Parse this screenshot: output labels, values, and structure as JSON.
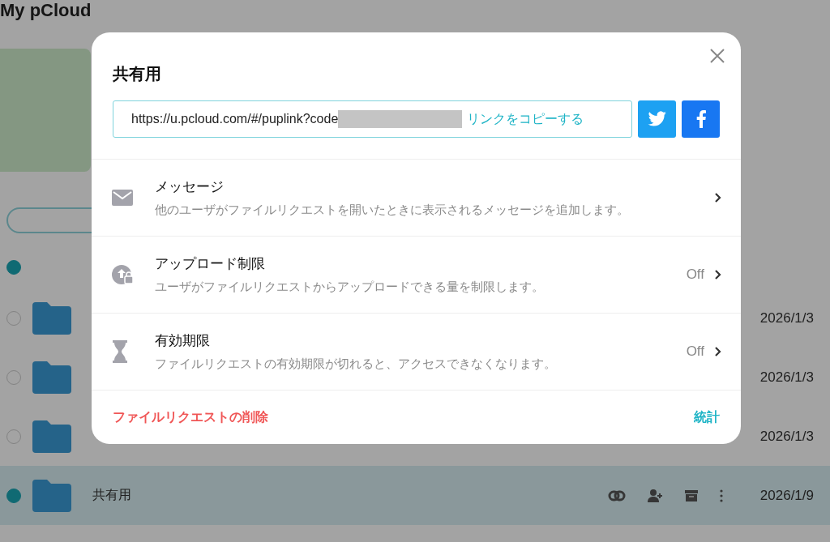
{
  "app": {
    "title": "My pCloud",
    "all_selected": true,
    "rows": [
      {
        "date": "2026/1/3",
        "selected": false
      },
      {
        "date": "2026/1/3",
        "selected": false
      },
      {
        "date": "2026/1/3",
        "selected": false
      },
      {
        "name": "共有用",
        "date": "2026/1/9",
        "selected": true
      }
    ]
  },
  "dialog": {
    "title": "共有用",
    "link": {
      "value": "https://u.pcloud.com/#/puplink?code",
      "copy_label": "リンクをコピーする"
    },
    "options": [
      {
        "kind": "message",
        "title": "メッセージ",
        "description": "他のユーザがファイルリクエストを開いたときに表示されるメッセージを追加します。"
      },
      {
        "kind": "upload_limit",
        "title": "アップロード制限",
        "description": "ユーザがファイルリクエストからアップロードできる量を制限します。",
        "value": "Off"
      },
      {
        "kind": "expiry",
        "title": "有効期限",
        "description": "ファイルリクエストの有効期限が切れると、アクセスできなくなります。",
        "value": "Off"
      }
    ],
    "delete_label": "ファイルリクエストの削除",
    "stats_label": "統計"
  }
}
